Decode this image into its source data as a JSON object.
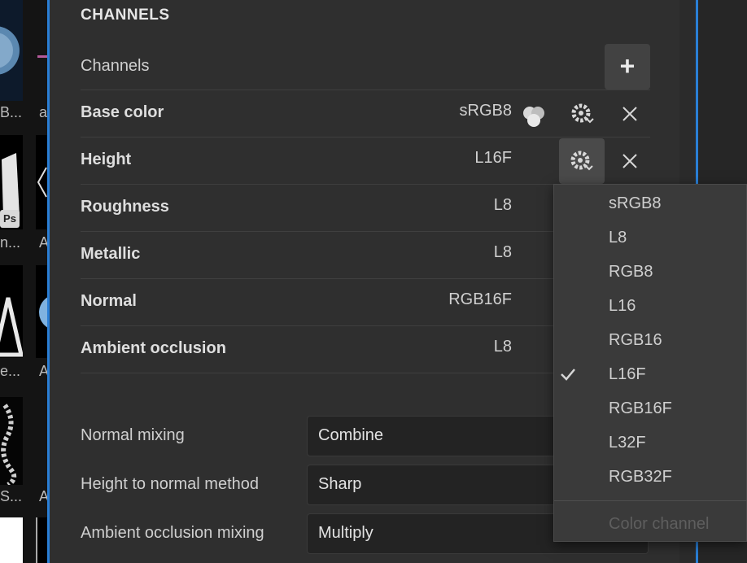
{
  "panel": {
    "section_title": "CHANNELS",
    "channels_label": "Channels",
    "add_icon": "plus-icon"
  },
  "channels": [
    {
      "name": "Base color",
      "format": "sRGB8",
      "has_mix_icon": true
    },
    {
      "name": "Height",
      "format": "L16F",
      "gear_active": true
    },
    {
      "name": "Roughness",
      "format": "L8"
    },
    {
      "name": "Metallic",
      "format": "L8"
    },
    {
      "name": "Normal",
      "format": "RGB16F"
    },
    {
      "name": "Ambient occlusion",
      "format": "L8"
    }
  ],
  "properties": [
    {
      "label": "Normal mixing",
      "value": "Combine"
    },
    {
      "label": "Height to normal method",
      "value": "Sharp"
    },
    {
      "label": "Ambient occlusion mixing",
      "value": "Multiply"
    }
  ],
  "format_menu": {
    "items": [
      "sRGB8",
      "L8",
      "RGB8",
      "L16",
      "RGB16",
      "L16F",
      "RGB16F",
      "L32F",
      "RGB32F"
    ],
    "selected": "L16F",
    "footer_disabled": "Color channel"
  },
  "asset_strip": {
    "labels": [
      "B...",
      "n...",
      "e...",
      "S..."
    ],
    "badge": "Ps",
    "letter": "a",
    "letter2": "A"
  },
  "colors": {
    "accent": "#2a7fd6",
    "panel_bg": "#2f2f2f"
  }
}
